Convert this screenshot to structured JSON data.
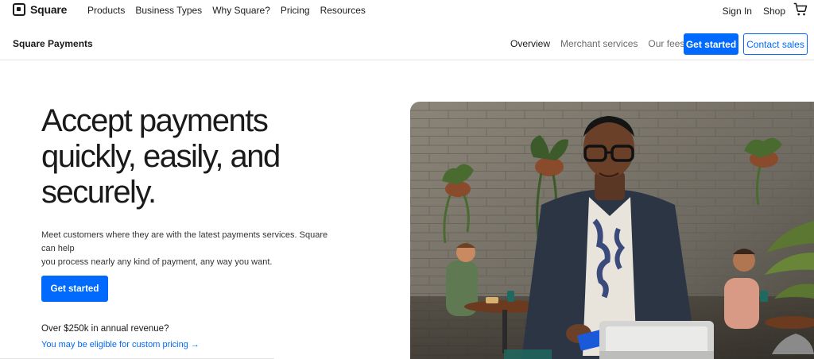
{
  "brand": {
    "name": "Square"
  },
  "topnav": {
    "links": [
      "Products",
      "Business Types",
      "Why Square?",
      "Pricing",
      "Resources"
    ],
    "sign_in": "Sign In",
    "shop": "Shop"
  },
  "subnav": {
    "title": "Square Payments",
    "links": [
      "Overview",
      "Merchant services",
      "Our fees"
    ],
    "get_started": "Get started",
    "contact_sales": "Contact sales"
  },
  "hero": {
    "title_lines": [
      "Accept payments",
      "quickly, easily, and",
      "securely."
    ],
    "description_lines": [
      "Meet customers where they are with the latest payments services. Square can help",
      "you process nearly any kind of payment, any way you want."
    ],
    "cta": "Get started",
    "revenue_question": "Over $250k in annual revenue?",
    "revenue_link": "You may be eligible for custom pricing →"
  },
  "colors": {
    "accent": "#006aff",
    "text": "#1a1a1a",
    "muted": "#6b6b6b"
  }
}
